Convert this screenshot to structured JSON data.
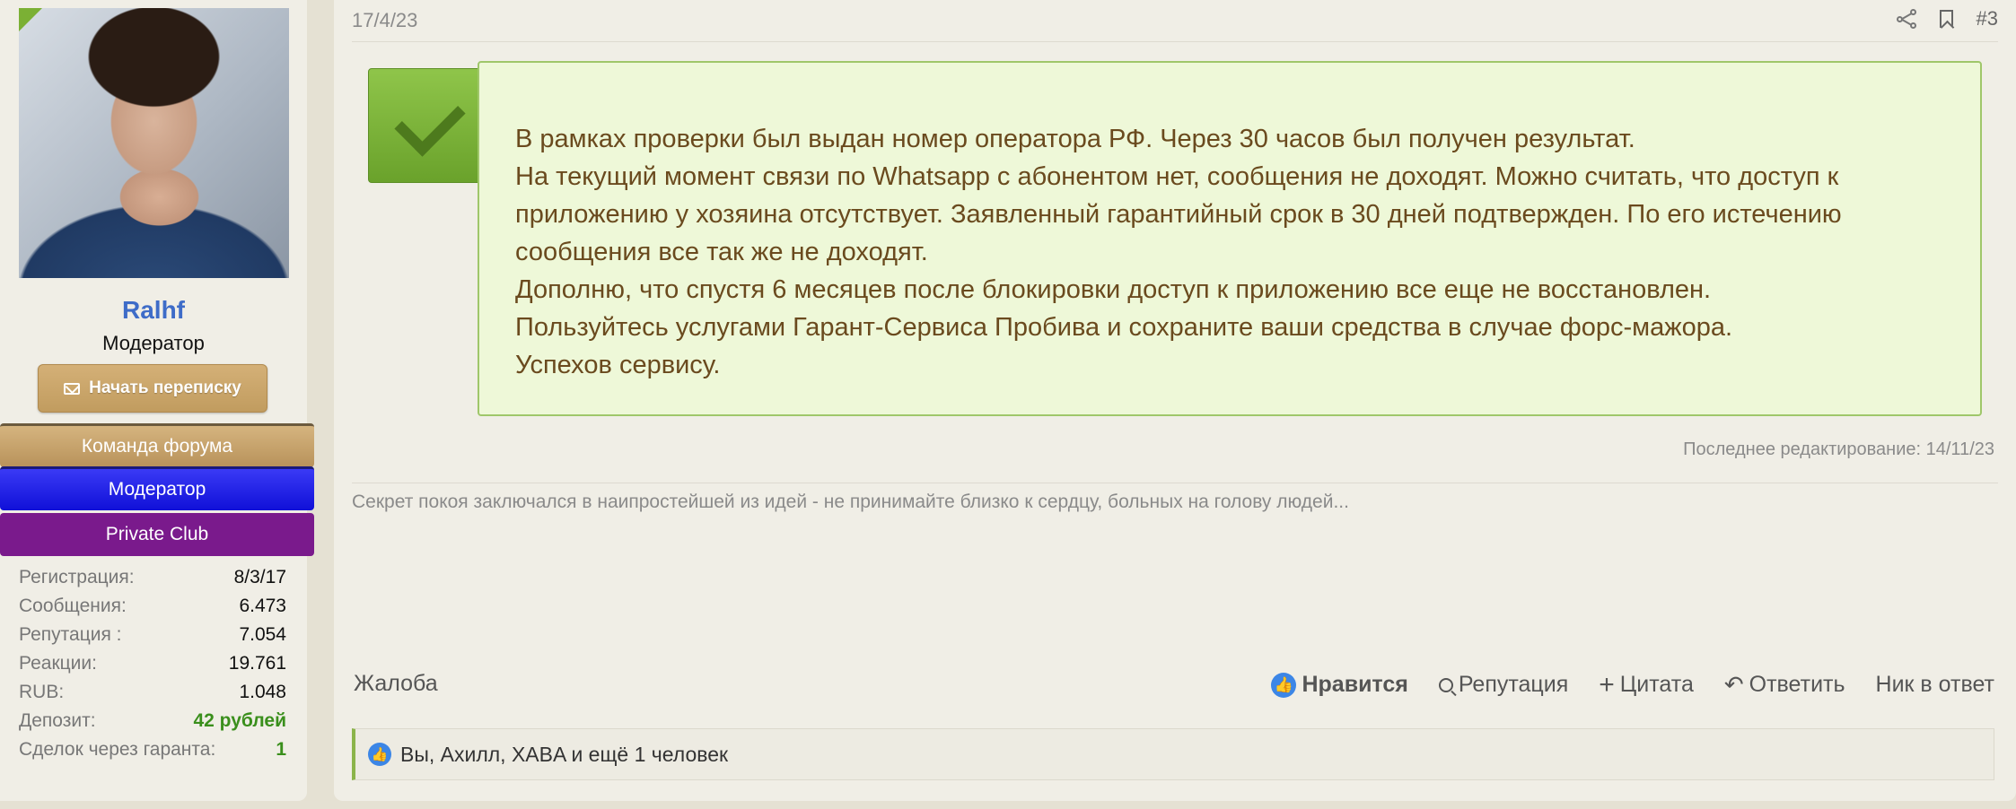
{
  "user": {
    "name": "Ralhf",
    "title": "Модератор",
    "pm_button": "Начать переписку",
    "banners": [
      "Команда форума",
      "Модератор",
      "Private Club"
    ],
    "stats": [
      {
        "label": "Регистрация:",
        "value": "8/3/17"
      },
      {
        "label": "Сообщения:",
        "value": "6.473"
      },
      {
        "label": "Репутация :",
        "value": "7.054"
      },
      {
        "label": "Реакции:",
        "value": "19.761"
      },
      {
        "label": "RUB:",
        "value": "1.048"
      },
      {
        "label": "Депозит:",
        "value": "42 рублей"
      },
      {
        "label": "Сделок через гаранта:",
        "value": "1"
      }
    ]
  },
  "post": {
    "date": "17/4/23",
    "number": "#3",
    "lines": [
      "В рамках проверки был выдан номер оператора РФ. Через 30 часов был получен результат.",
      "На текущий момент связи по Whatsapp с абонентом нет, сообщения не доходят. Можно считать, что доступ к",
      "приложению у хозяина отсутствует. Заявленный гарантийный срок в 30 дней подтвержден. По его истечению",
      "сообщения все так же не доходят.",
      "Дополню, что спустя 6 месяцев после блокировки доступ к приложению все еще не восстановлен.",
      "Пользуйтесь услугами Гарант-Сервиса Пробива и сохраните ваши средства в случае форс-мажора.",
      "Успехов сервису."
    ],
    "edited": "Последнее редактирование: 14/11/23",
    "signature": "Секрет покоя заключался в наипростейшей из идей - не принимайте близко к сердцу, больных на голову людей..."
  },
  "actions": {
    "report": "Жалоба",
    "like": "Нравится",
    "reputation": "Репутация",
    "quote": "Цитата",
    "reply": "Ответить",
    "nick_reply": "Ник в ответ"
  },
  "likes": "Вы, Ахилл, XABA и ещё 1 человек",
  "colors": {
    "accent_green": "#7bb034",
    "link_blue": "#3e6cc8",
    "moderator_banner": "#1010d8",
    "club_banner": "#7a1a8c"
  }
}
